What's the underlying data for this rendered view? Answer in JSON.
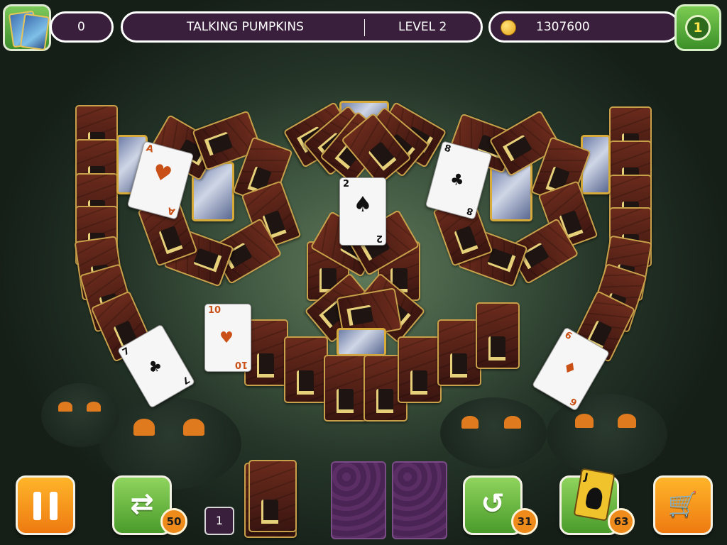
{
  "topbar": {
    "score": "0",
    "game_title": "TALKING PUMPKINS",
    "level_label": "LEVEL 2",
    "coins": "1307600",
    "player_level": "1"
  },
  "board": {
    "face_cards": [
      {
        "id": "ace-hearts",
        "rank": "A",
        "suit": "♥",
        "color": "red"
      },
      {
        "id": "two-spades",
        "rank": "2",
        "suit": "♠",
        "color": "black"
      },
      {
        "id": "eight-clubs",
        "rank": "8",
        "suit": "♣",
        "color": "black"
      },
      {
        "id": "ten-hearts",
        "rank": "10",
        "suit": "♥",
        "color": "red"
      },
      {
        "id": "seven-clubs",
        "rank": "7",
        "suit": "♣",
        "color": "black"
      },
      {
        "id": "six-diamonds",
        "rank": "6",
        "suit": "♦",
        "color": "red"
      }
    ]
  },
  "bottombar": {
    "shuffle_count": "50",
    "stock_count": "1",
    "undo_count": "31",
    "joker_count": "63",
    "joker_rank": "J"
  },
  "colors": {
    "panel_bg": "#3a1f3d",
    "accent_orange": "#ee7a11",
    "accent_green": "#4a9b2b",
    "card_back": "#4a1a12"
  }
}
